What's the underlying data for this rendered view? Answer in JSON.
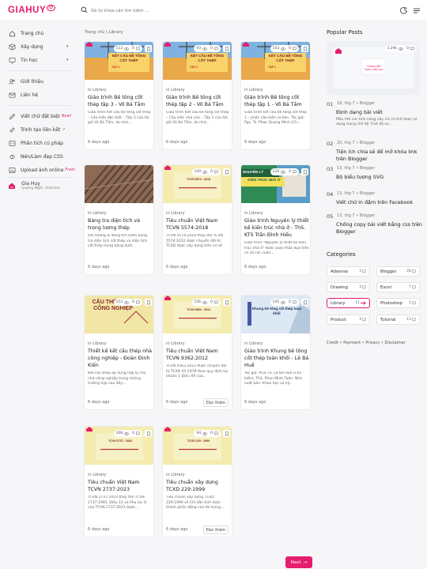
{
  "header": {
    "logo": "GIAHUY",
    "logo_mark": "ID",
    "search_placeholder": "Gõ từ khóa cần tìm kiếm ..."
  },
  "sidebar": {
    "items": [
      {
        "label": "Trang chủ",
        "icon": "home-icon"
      },
      {
        "label": "Xây dựng",
        "icon": "cube-icon",
        "chevron": "▾"
      },
      {
        "label": "Tin học",
        "icon": "monitor-icon",
        "chevron": "▾"
      },
      {
        "label": "Giới thiệu",
        "icon": "users-icon"
      },
      {
        "label": "Liên hệ",
        "icon": "mail-icon"
      },
      {
        "label": "Viết chữ đặt biệt",
        "icon": "pen-icon",
        "extra": "New!"
      },
      {
        "label": "Trình tạo liên kết",
        "icon": "link-icon",
        "arrow": "↗"
      },
      {
        "label": "Phân tích cú pháp",
        "icon": "code-icon"
      },
      {
        "label": "Nén/Làm đẹp CSS",
        "icon": "compress-icon"
      },
      {
        "label": "Upload ảnh online",
        "icon": "upload-icon",
        "extra": "Free!"
      }
    ],
    "profile": {
      "name": "Gia Huy",
      "location": "Quảng Ngãi, Vietnam"
    }
  },
  "breadcrumb": {
    "home": "Trang chủ",
    "sep": "\\",
    "current": "Library"
  },
  "posts": [
    {
      "views": "113",
      "comments": "0",
      "category": "Library",
      "title": "Giáo trình Bê tông cốt thép tập 3 - Võ Bá Tầm",
      "snippet": "Giáo trình Kết cấu bê tông cốt thép – Cấu kiện đặc biệt – Tập 3 của tác giả Võ Bá Tầm, do nhà...",
      "date": "6 days ago",
      "thumb_title": "KẾT CẤU BÊ TÔNG CỐT THÉP",
      "thumb_sub": "TẬP 3"
    },
    {
      "views": "93",
      "comments": "0",
      "category": "Library",
      "title": "Giáo trình Bê tông cốt thép tập 2 - Võ Bá Tầm",
      "snippet": "Giáo trình Kết cấu bê tông cốt thép – Cấu kiện nhà cửa – Tập 2 của tác giả Võ Bá Tầm, do nhà...",
      "date": "6 days ago",
      "thumb_title": "KẾT CẤU BÊ TÔNG CỐT THÉP",
      "thumb_sub": "TẬP 2"
    },
    {
      "views": "103",
      "comments": "0",
      "category": "Library",
      "title": "Giáo trình Bê tông cốt thép tập 1 - Võ Bá Tầm",
      "snippet": "Giáo trình kết cấu bê tông cốt thép 1 – phần cấu kiện cơ bản. Tác giả: Pgs. Ts. Phan Quang Minh (Ch...",
      "date": "6 days ago",
      "thumb_title": "KẾT CẤU BÊ TÔNG CỐT THÉP",
      "thumb_sub": "TẬP 1"
    },
    {
      "views": "",
      "comments": "",
      "category": "Library",
      "title": "Bảng tra diện tích và trọng lượng thép",
      "snippet": "Với những ai đang tìm kiếm bảng tra diện tích cốt thép và diện tích cốt thép trong bảng dưới...",
      "date": "6 days ago",
      "thumb_title": "",
      "thumb_sub": ""
    },
    {
      "views": "140",
      "comments": "0",
      "category": "Library",
      "title": "Tiêu chuẩn Việt Nam TCVN 5574-2018",
      "snippet": "TCVN 5574-2018 thay thế TCVN 5574:2012 được chuyển đổi từ TCXD được xây dựng trên cơ sở thay...",
      "date": "6 days ago",
      "thumb_title": "TCVN 5574 : 2018",
      "thumb_sub": ""
    },
    {
      "views": "124",
      "comments": "0",
      "category": "Library",
      "title": "Giáo trình Nguyên lý thiết kế kiến trúc nhà ở - ThS. KTS Trần Đình Hiếu",
      "snippet": "Giáo trình \"Nguyên lý thiết kế kiến trúc nhà ở\" được soạn thảo dựa trên cơ sở các cuốn...",
      "date": "6 days ago",
      "thumb_title": "KIẾN TRÚC NHÀ Ở",
      "thumb_sub": "NGUYÊN LÝ"
    },
    {
      "views": "153",
      "comments": "0",
      "category": "Library",
      "title": "Thiết kế kết cấu thép nhà công nghiệp - Đoàn Định Kiến",
      "snippet": "Kết cấu thép áp dụng hợp lý cho nhà công nghiệp trong những trường hợp sau đây:...",
      "date": "6 days ago",
      "thumb_title": "CẤU THÉP NHÀ CÔNG NGHIỆP",
      "thumb_sub": ""
    },
    {
      "views": "156",
      "comments": "0",
      "category": "Library",
      "title": "Tiêu chuẩn Việt Nam TCVN 9362:2012",
      "snippet": "TCVN 9362:2012 được chuyển đổi từ TCXD 45:1978 theo quy định tại khoản 1 Điều 69 của...",
      "date": "6 days ago",
      "thumb_title": "TCVN 9362 : 2012",
      "thumb_sub": "",
      "read_more": "Đọc thêm"
    },
    {
      "views": "145",
      "comments": "0",
      "category": "Library",
      "title": "Giáo trình Khung bê tông cốt thép toàn khối - Lê Bá Huế",
      "snippet": "Tác giả: PGS.TS. Lê Bá Huế (Chủ biên), ThS. Phan Minh Tuấn. Nhà xuất bản: Khoa học và kỹ...",
      "date": "6 days ago",
      "thumb_title": "Khung bê tông cốt thép toàn khối",
      "thumb_sub": ""
    },
    {
      "views": "208",
      "comments": "0",
      "category": "Library",
      "title": "Tiêu chuẩn Việt Nam TCVN 2737:2023",
      "snippet": "TCVN 2737:2023 thay thế TCVN 2737:1995. Điều 11 và Phụ lục G của TCVN 2737:2023 được...",
      "date": "6 days ago",
      "thumb_title": "TCVN 2737 : 2023",
      "thumb_sub": ""
    },
    {
      "views": "94",
      "comments": "0",
      "category": "Library",
      "title": "Tiêu chuẩn xây dựng TCXD 229:1999",
      "snippet": "Tiêu chuẩn xây dựng TCXD 229:1999 về Chỉ dẫn tính toán thành phần động của tải trọng...",
      "date": "6 days ago",
      "thumb_title": "TCXD 229 : 1999",
      "thumb_sub": "",
      "read_more": "Đọc thêm"
    }
  ],
  "popular": {
    "heading": "Popular Posts",
    "featured": {
      "views": "3.29k",
      "comments": "0",
      "caption": "Hướng dẫn thêm một icon"
    },
    "items": [
      {
        "num": "01",
        "date": "18, thg 7",
        "sep": "•",
        "label": "Blogger",
        "title": "Định dạng bài viết",
        "snippet": "Mẫu hết các tính năng này chỉ có thể được sử dụng trong chế độ 'Chế độ xe..."
      },
      {
        "num": "02",
        "date": "20, thg 7",
        "sep": "•",
        "label": "Blogger",
        "title": "Tiện ích chia sẻ để mở khóa link trên Blogger"
      },
      {
        "num": "03",
        "date": "13, thg 7",
        "sep": "•",
        "label": "Blogger",
        "title": "Bộ biểu tượng SVG"
      },
      {
        "num": "04",
        "date": "13, thg 7",
        "sep": "•",
        "label": "Blogger",
        "title": "Viết chữ in đậm trên Facebook"
      },
      {
        "num": "05",
        "date": "13, thg 7",
        "sep": "•",
        "label": "Blogger",
        "title": "Chống copy bài viết bằng css trên Blogger"
      }
    ]
  },
  "categories": {
    "heading": "Categories",
    "items": [
      {
        "name": "Adsense",
        "count": "3"
      },
      {
        "name": "Blogger",
        "count": "26"
      },
      {
        "name": "Drawing",
        "count": "3"
      },
      {
        "name": "Excel",
        "count": "7"
      },
      {
        "name": "Library",
        "count": "11"
      },
      {
        "name": "Photoshop",
        "count": "2"
      },
      {
        "name": "Product",
        "count": "3"
      },
      {
        "name": "Tutorial",
        "count": "13"
      }
    ],
    "active": "Library"
  },
  "footer_links": [
    "Credit",
    "Payment",
    "Privacy",
    "Disclaimer"
  ],
  "footer_sep": "•",
  "pagination": {
    "next": "Next"
  },
  "colors": {
    "accent": "#e51d6e",
    "bg": "#f6f6f8",
    "thumb_cream": "#f4ecae"
  }
}
